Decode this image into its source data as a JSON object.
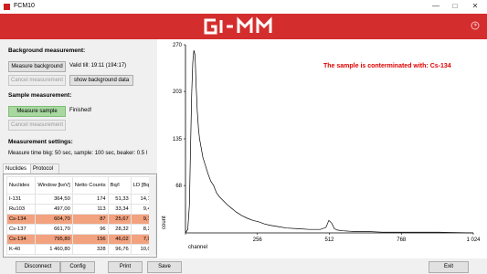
{
  "window": {
    "title": "FCM10",
    "minimize_icon": "minimize-icon",
    "maximize_icon": "maximize-icon",
    "close_icon": "close-icon"
  },
  "banner": {
    "logo": "GI-MM",
    "help_icon": "help-icon",
    "color": "#d42d2d"
  },
  "background": {
    "section_title": "Background measurement:",
    "measure_button": "Measure background",
    "valid_till": "Valid till: 19:11 (194:17)",
    "cancel_button": "Cancel measurement",
    "show_data_button": "show background data"
  },
  "sample": {
    "section_title": "Sample measurement:",
    "measure_button": "Measure sample",
    "status": "Finished!",
    "cancel_button": "Cancel measurement"
  },
  "settings": {
    "section_title": "Measurement settings:",
    "text": "Measure time bkg: 50 sec, sample: 100 sec, beaker: 0.5 l"
  },
  "tabs": [
    "Nuclides",
    "Protocol"
  ],
  "table": {
    "headers": [
      "Nuclides",
      "Window [keV]",
      "Netto Counts",
      "Bq/l",
      "LD [Bq/l]"
    ],
    "rows": [
      {
        "cells": [
          "I-131",
          "364,50",
          "174",
          "51,33",
          "14,16"
        ],
        "highlight": false
      },
      {
        "cells": [
          "Ru103",
          "497,00",
          "113",
          "33,34",
          "9,44"
        ],
        "highlight": false
      },
      {
        "cells": [
          "Cs-134",
          "604,70",
          "87",
          "25,67",
          "9,15"
        ],
        "highlight": true
      },
      {
        "cells": [
          "Cs-137",
          "661,70",
          "96",
          "28,32",
          "8,26"
        ],
        "highlight": false
      },
      {
        "cells": [
          "Cs-134",
          "795,80",
          "156",
          "46,02",
          "7,97"
        ],
        "highlight": true
      },
      {
        "cells": [
          "K-40",
          "1 460,80",
          "328",
          "96,76",
          "10,03"
        ],
        "highlight": false
      }
    ]
  },
  "contamination_message": "The sample is conterminated with: Cs-134",
  "bottom_buttons": [
    "Disconnect",
    "Config",
    "Print",
    "Save",
    "Exit"
  ],
  "chart_data": {
    "type": "line",
    "xlabel": "channel",
    "ylabel": "count",
    "xlim": [
      0,
      1024
    ],
    "ylim": [
      0,
      270
    ],
    "x_ticks": [
      0,
      256,
      512,
      768,
      1024
    ],
    "x_tick_labels": [
      "0",
      "256",
      "512",
      "768",
      "1 024"
    ],
    "y_ticks": [
      68,
      135,
      203,
      270
    ],
    "y_tick_labels": [
      "68",
      "135",
      "203",
      "270"
    ],
    "series": [
      {
        "x": [
          0,
          8,
          14,
          18,
          22,
          26,
          30,
          34,
          38,
          42,
          46,
          50,
          56,
          62,
          70,
          80,
          90,
          100,
          110,
          120,
          135,
          150,
          165,
          180,
          200,
          220,
          240,
          260,
          280,
          300,
          330,
          360,
          400,
          440,
          480,
          500,
          510,
          520,
          530,
          540,
          560,
          600,
          650,
          700,
          800,
          900,
          1024
        ],
        "y": [
          0,
          5,
          40,
          120,
          200,
          245,
          262,
          255,
          210,
          175,
          150,
          135,
          122,
          108,
          98,
          85,
          74,
          68,
          58,
          52,
          46,
          40,
          35,
          30,
          25,
          21,
          18,
          16,
          13,
          11,
          9,
          7,
          6,
          5,
          5,
          8,
          18,
          14,
          6,
          4,
          3,
          2,
          2,
          1,
          1,
          1,
          0
        ]
      }
    ]
  }
}
